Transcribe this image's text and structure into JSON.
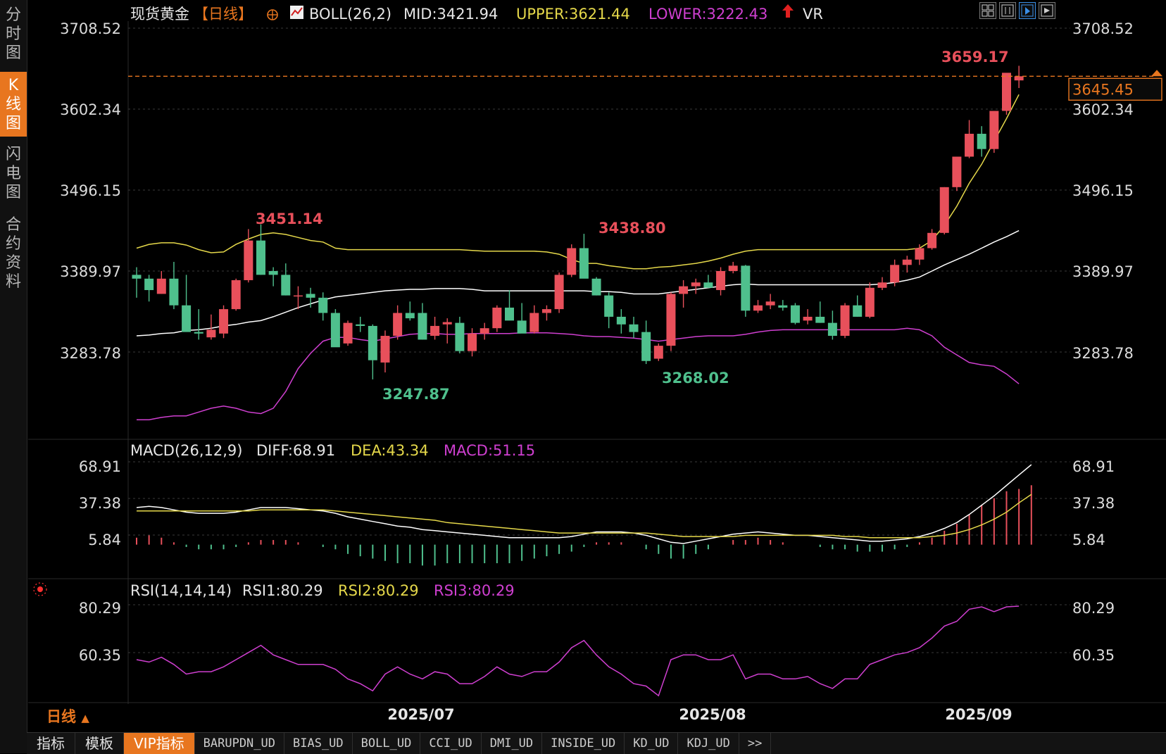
{
  "colors": {
    "background": "#000000",
    "up": "#e8505b",
    "down": "#4fc08d",
    "mid": "#ffffff",
    "upper": "#e5d84a",
    "lower": "#cf3fd0",
    "accent": "#e8761f",
    "grid": "#3a3a3a"
  },
  "side_tabs": [
    {
      "label": "分时图",
      "active": false
    },
    {
      "label": "K线图",
      "active": true
    },
    {
      "label": "闪电图",
      "active": false
    },
    {
      "label": "合约资料",
      "active": false
    }
  ],
  "main_header": {
    "symbol": "现货黄金",
    "period_tag": "【日线】",
    "indicator": "BOLL(26,2)",
    "mid_text": "MID:3421.94",
    "upper_text": "UPPER:3621.44",
    "lower_text": "LOWER:3222.43",
    "extra": "VR"
  },
  "toolbar_icons": [
    "layout-grid-icon",
    "chart-type-icon",
    "cursor-mode-icon",
    "fullscreen-icon"
  ],
  "price_axis": {
    "labels": [
      "3708.52",
      "3602.34",
      "3496.15",
      "3389.97",
      "3283.78"
    ],
    "current_price": "3645.45"
  },
  "annotations": {
    "high1": "3451.14",
    "high2": "3438.80",
    "low1": "3247.87",
    "low2": "3268.02",
    "top": "3659.17"
  },
  "macd_header": {
    "name": "MACD(26,12,9)",
    "diff": "DIFF:68.91",
    "dea": "DEA:43.34",
    "macd": "MACD:51.15"
  },
  "macd_axis": [
    "68.91",
    "37.38",
    "5.84"
  ],
  "rsi_header": {
    "name": "RSI(14,14,14)",
    "rsi1": "RSI1:80.29",
    "rsi2": "RSI2:80.29",
    "rsi3": "RSI3:80.29"
  },
  "rsi_axis": [
    "80.29",
    "60.35"
  ],
  "date_labels": [
    "2025/07",
    "2025/08",
    "2025/09"
  ],
  "period_selector": "日线",
  "bottom_tabs": [
    "指标",
    "模板",
    "VIP指标",
    "BARUPDN_UD",
    "BIAS_UD",
    "BOLL_UD",
    "CCI_UD",
    "DMI_UD",
    "INSIDE_UD",
    "KD_UD",
    "KDJ_UD",
    ">>"
  ],
  "chart_data": {
    "type": "candlestick",
    "price_range": [
      3180,
      3740
    ],
    "candles": [
      [
        3385,
        3395,
        3355,
        3380
      ],
      [
        3380,
        3385,
        3350,
        3365
      ],
      [
        3360,
        3390,
        3360,
        3380
      ],
      [
        3380,
        3402,
        3340,
        3345
      ],
      [
        3345,
        3385,
        3318,
        3310
      ],
      [
        3310,
        3340,
        3300,
        3308
      ],
      [
        3303,
        3333,
        3300,
        3313
      ],
      [
        3308,
        3345,
        3302,
        3340
      ],
      [
        3340,
        3380,
        3338,
        3378
      ],
      [
        3378,
        3445,
        3375,
        3430
      ],
      [
        3430,
        3451.14,
        3385,
        3385
      ],
      [
        3390,
        3395,
        3370,
        3385
      ],
      [
        3385,
        3400,
        3358,
        3358
      ],
      [
        3358,
        3370,
        3340,
        3358
      ],
      [
        3360,
        3368,
        3342,
        3355
      ],
      [
        3355,
        3362,
        3325,
        3335
      ],
      [
        3335,
        3340,
        3300,
        3290
      ],
      [
        3295,
        3325,
        3292,
        3322
      ],
      [
        3320,
        3330,
        3310,
        3318
      ],
      [
        3318,
        3320,
        3247.87,
        3273
      ],
      [
        3270,
        3312,
        3257,
        3305
      ],
      [
        3305,
        3345,
        3300,
        3335
      ],
      [
        3335,
        3350,
        3325,
        3328
      ],
      [
        3335,
        3348,
        3300,
        3300
      ],
      [
        3305,
        3330,
        3300,
        3318
      ],
      [
        3320,
        3328,
        3295,
        3323
      ],
      [
        3322,
        3330,
        3282,
        3285
      ],
      [
        3285,
        3315,
        3278,
        3308
      ],
      [
        3308,
        3322,
        3300,
        3315
      ],
      [
        3315,
        3345,
        3310,
        3342
      ],
      [
        3342,
        3365,
        3328,
        3325
      ],
      [
        3325,
        3348,
        3312,
        3308
      ],
      [
        3310,
        3345,
        3308,
        3335
      ],
      [
        3335,
        3345,
        3325,
        3340
      ],
      [
        3340,
        3388,
        3335,
        3385
      ],
      [
        3385,
        3425,
        3382,
        3420
      ],
      [
        3420,
        3438.8,
        3382,
        3380
      ],
      [
        3380,
        3382,
        3358,
        3358
      ],
      [
        3358,
        3362,
        3315,
        3330
      ],
      [
        3330,
        3340,
        3308,
        3320
      ],
      [
        3320,
        3330,
        3302,
        3310
      ],
      [
        3310,
        3325,
        3268.02,
        3272
      ],
      [
        3275,
        3295,
        3272,
        3292
      ],
      [
        3292,
        3362,
        3285,
        3360
      ],
      [
        3360,
        3378,
        3342,
        3370
      ],
      [
        3370,
        3380,
        3360,
        3375
      ],
      [
        3375,
        3385,
        3368,
        3368
      ],
      [
        3365,
        3395,
        3358,
        3390
      ],
      [
        3390,
        3402,
        3387,
        3397
      ],
      [
        3397,
        3398,
        3330,
        3338
      ],
      [
        3338,
        3352,
        3335,
        3345
      ],
      [
        3345,
        3360,
        3340,
        3350
      ],
      [
        3345,
        3352,
        3338,
        3342
      ],
      [
        3345,
        3348,
        3320,
        3322
      ],
      [
        3325,
        3340,
        3320,
        3330
      ],
      [
        3330,
        3350,
        3322,
        3322
      ],
      [
        3322,
        3338,
        3300,
        3305
      ],
      [
        3305,
        3348,
        3302,
        3345
      ],
      [
        3345,
        3358,
        3330,
        3330
      ],
      [
        3330,
        3375,
        3328,
        3368
      ],
      [
        3368,
        3382,
        3365,
        3375
      ],
      [
        3375,
        3405,
        3370,
        3398
      ],
      [
        3398,
        3410,
        3388,
        3405
      ],
      [
        3405,
        3425,
        3398,
        3420
      ],
      [
        3420,
        3445,
        3418,
        3440
      ],
      [
        3440,
        3500,
        3438,
        3500
      ],
      [
        3500,
        3540,
        3495,
        3540
      ],
      [
        3540,
        3588,
        3538,
        3570
      ],
      [
        3570,
        3580,
        3540,
        3550
      ],
      [
        3550,
        3598,
        3545,
        3600
      ],
      [
        3600,
        3640,
        3595,
        3650
      ],
      [
        3640,
        3659.17,
        3630,
        3645.45
      ]
    ],
    "boll_mid": [
      3305,
      3306,
      3308,
      3309,
      3312,
      3313,
      3315,
      3318,
      3320,
      3323,
      3325,
      3330,
      3336,
      3342,
      3347,
      3352,
      3356,
      3358,
      3360,
      3362,
      3364,
      3365,
      3366,
      3366,
      3367,
      3367,
      3367,
      3366,
      3364,
      3364,
      3364,
      3364,
      3364,
      3364,
      3364,
      3364,
      3364,
      3363,
      3363,
      3362,
      3360,
      3360,
      3360,
      3362,
      3364,
      3366,
      3368,
      3370,
      3372,
      3373,
      3372,
      3372,
      3372,
      3372,
      3372,
      3372,
      3372,
      3372,
      3372,
      3372,
      3373,
      3375,
      3378,
      3382,
      3390,
      3398,
      3405,
      3412,
      3420,
      3428,
      3435,
      3443
    ],
    "boll_upper": [
      3420,
      3425,
      3427,
      3427,
      3424,
      3418,
      3414,
      3415,
      3425,
      3432,
      3438,
      3440,
      3438,
      3434,
      3430,
      3428,
      3420,
      3418,
      3418,
      3418,
      3418,
      3418,
      3418,
      3418,
      3418,
      3418,
      3418,
      3417,
      3416,
      3416,
      3416,
      3416,
      3416,
      3415,
      3412,
      3405,
      3400,
      3400,
      3397,
      3395,
      3393,
      3393,
      3395,
      3396,
      3398,
      3400,
      3403,
      3407,
      3412,
      3416,
      3418,
      3418,
      3418,
      3418,
      3418,
      3418,
      3418,
      3418,
      3418,
      3418,
      3418,
      3418,
      3418,
      3420,
      3430,
      3450,
      3475,
      3505,
      3530,
      3560,
      3590,
      3621.44
    ],
    "boll_lower": [
      3195,
      3195,
      3198,
      3200,
      3200,
      3205,
      3210,
      3213,
      3210,
      3205,
      3203,
      3210,
      3232,
      3262,
      3282,
      3298,
      3303,
      3303,
      3300,
      3298,
      3301,
      3304,
      3307,
      3308,
      3308,
      3307,
      3307,
      3308,
      3308,
      3308,
      3308,
      3309,
      3309,
      3309,
      3308,
      3307,
      3305,
      3304,
      3304,
      3303,
      3302,
      3300,
      3298,
      3300,
      3302,
      3304,
      3305,
      3305,
      3305,
      3307,
      3310,
      3312,
      3313,
      3313,
      3313,
      3313,
      3313,
      3313,
      3313,
      3313,
      3313,
      3313,
      3315,
      3313,
      3305,
      3290,
      3280,
      3270,
      3267,
      3265,
      3255,
      3242
    ],
    "diff": [
      32,
      33,
      32,
      30,
      28,
      27,
      27,
      27,
      28,
      30,
      32,
      32,
      32,
      31,
      30,
      29,
      27,
      24,
      22,
      20,
      18,
      16,
      15,
      13,
      12,
      11,
      10,
      9,
      8,
      7,
      6,
      6,
      6,
      6,
      6,
      7,
      9,
      11,
      11,
      11,
      10,
      8,
      5,
      2,
      1,
      3,
      5,
      7,
      9,
      10,
      11,
      10,
      9,
      8,
      8,
      7,
      6,
      5,
      4,
      3,
      3,
      4,
      5,
      7,
      10,
      14,
      19,
      26,
      34,
      42,
      51,
      60,
      68.91
    ],
    "dea": [
      29,
      29,
      29,
      29,
      29,
      29,
      29,
      29,
      29,
      29,
      30,
      30,
      30,
      30,
      30,
      30,
      29,
      28,
      27,
      26,
      25,
      24,
      23,
      22,
      21,
      19,
      18,
      17,
      16,
      15,
      14,
      13,
      12,
      11,
      10,
      10,
      10,
      10,
      10,
      10,
      10,
      10,
      9,
      8,
      7,
      7,
      7,
      7,
      7,
      8,
      8,
      8,
      8,
      8,
      8,
      8,
      8,
      7,
      7,
      6,
      6,
      6,
      6,
      6,
      7,
      8,
      10,
      13,
      17,
      22,
      28,
      36,
      43.34
    ],
    "macd_bars": [
      6,
      8,
      6,
      2,
      -2,
      -4,
      -4,
      -4,
      -2,
      2,
      4,
      4,
      4,
      2,
      0,
      -2,
      -4,
      -8,
      -10,
      -12,
      -14,
      -16,
      -16,
      -18,
      -18,
      -16,
      -16,
      -16,
      -16,
      -16,
      -16,
      -14,
      -12,
      -10,
      -8,
      -6,
      -2,
      2,
      2,
      2,
      0,
      -4,
      -8,
      -12,
      -12,
      -8,
      -4,
      0,
      4,
      4,
      6,
      4,
      2,
      0,
      0,
      -2,
      -4,
      -4,
      -6,
      -6,
      -6,
      -4,
      -2,
      2,
      6,
      12,
      18,
      26,
      34,
      40,
      46,
      48,
      51.15
    ],
    "rsi": [
      58,
      57,
      59,
      56,
      52,
      53,
      53,
      55,
      58,
      61,
      64,
      60,
      58,
      56,
      56,
      56,
      54,
      50,
      48,
      45,
      52,
      55,
      52,
      50,
      53,
      52,
      48,
      48,
      51,
      55,
      52,
      51,
      53,
      53,
      57,
      63,
      66,
      60,
      55,
      52,
      48,
      47,
      43,
      58,
      60,
      60,
      58,
      58,
      60,
      50,
      52,
      52,
      50,
      50,
      51,
      48,
      46,
      50,
      50,
      56,
      58,
      60,
      61,
      63,
      67,
      72,
      74,
      79,
      80,
      78,
      80,
      80.29
    ]
  }
}
